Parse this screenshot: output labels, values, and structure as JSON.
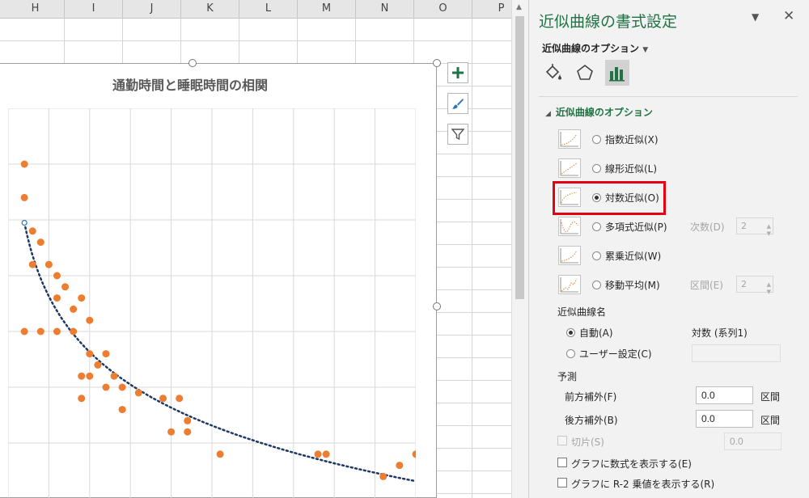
{
  "sheet": {
    "columns": [
      "H",
      "I",
      "J",
      "K",
      "L",
      "M",
      "N",
      "O",
      "P"
    ]
  },
  "chart": {
    "title": "通勤時間と睡眠時間の相関",
    "button_icons": [
      "plus-icon",
      "brush-icon",
      "filter-icon"
    ],
    "marker_color": "#ED7D31",
    "trendline_color": "#1F3864"
  },
  "chart_data": {
    "type": "scatter",
    "title": "通勤時間と睡眠時間の相関",
    "xlabel": "",
    "ylabel": "",
    "grid": true,
    "series": [
      {
        "name": "系列1",
        "points": [
          [
            1.0,
            6.5
          ],
          [
            1.0,
            6.2
          ],
          [
            1.5,
            5.9
          ],
          [
            1.5,
            5.6
          ],
          [
            2.5,
            5.6
          ],
          [
            2.0,
            5.8
          ],
          [
            3.0,
            5.5
          ],
          [
            3.0,
            5.3
          ],
          [
            3.5,
            5.4
          ],
          [
            4.0,
            5.2
          ],
          [
            4.0,
            5.0
          ],
          [
            4.5,
            5.3
          ],
          [
            1.0,
            5.0
          ],
          [
            2.0,
            5.0
          ],
          [
            3.0,
            5.0
          ],
          [
            5.0,
            5.1
          ],
          [
            5.0,
            4.8
          ],
          [
            6.0,
            4.8
          ],
          [
            5.5,
            4.7
          ],
          [
            4.5,
            4.6
          ],
          [
            5.0,
            4.6
          ],
          [
            6.5,
            4.6
          ],
          [
            4.5,
            4.4
          ],
          [
            6.0,
            4.5
          ],
          [
            7.0,
            4.5
          ],
          [
            8.0,
            4.45
          ],
          [
            9.5,
            4.4
          ],
          [
            10.5,
            4.4
          ],
          [
            7.0,
            4.3
          ],
          [
            10.0,
            4.1
          ],
          [
            11.0,
            4.1
          ],
          [
            11.0,
            4.2
          ],
          [
            13.0,
            3.9
          ],
          [
            19.0,
            3.9
          ],
          [
            19.5,
            3.9
          ],
          [
            23.0,
            3.7
          ],
          [
            24.0,
            3.8
          ],
          [
            25.0,
            3.9
          ]
        ],
        "trendline": "logarithmic"
      }
    ]
  },
  "pane": {
    "title": "近似曲線の書式設定",
    "options_menu": "近似曲線のオプション",
    "tabs": [
      "fill-line-icon",
      "effects-icon",
      "trendline-options-icon"
    ],
    "section_title": "近似曲線のオプション",
    "types": [
      {
        "label": "指数近似(X)",
        "key": "X",
        "selected": false
      },
      {
        "label": "線形近似(L)",
        "key": "L",
        "selected": false
      },
      {
        "label": "対数近似(O)",
        "key": "O",
        "selected": true
      },
      {
        "label": "多項式近似(P)",
        "key": "P",
        "selected": false,
        "param_label": "次数(D)",
        "param_value": "2"
      },
      {
        "label": "累乗近似(W)",
        "key": "W",
        "selected": false
      },
      {
        "label": "移動平均(M)",
        "key": "M",
        "selected": false,
        "param_label": "区間(E)",
        "param_value": "2"
      }
    ],
    "name_section": "近似曲線名",
    "name_auto": "自動(A)",
    "name_auto_value": "対数 (系列1)",
    "name_custom": "ユーザー設定(C)",
    "forecast_section": "予測",
    "forward_label": "前方補外(F)",
    "forward_value": "0.0",
    "backward_label": "後方補外(B)",
    "backward_value": "0.0",
    "period_unit": "区間",
    "intercept_label": "切片(S)",
    "intercept_value": "0.0",
    "show_equation": "グラフに数式を表示する(E)",
    "show_r2": "グラフに R-2 乗値を表示する(R)"
  }
}
